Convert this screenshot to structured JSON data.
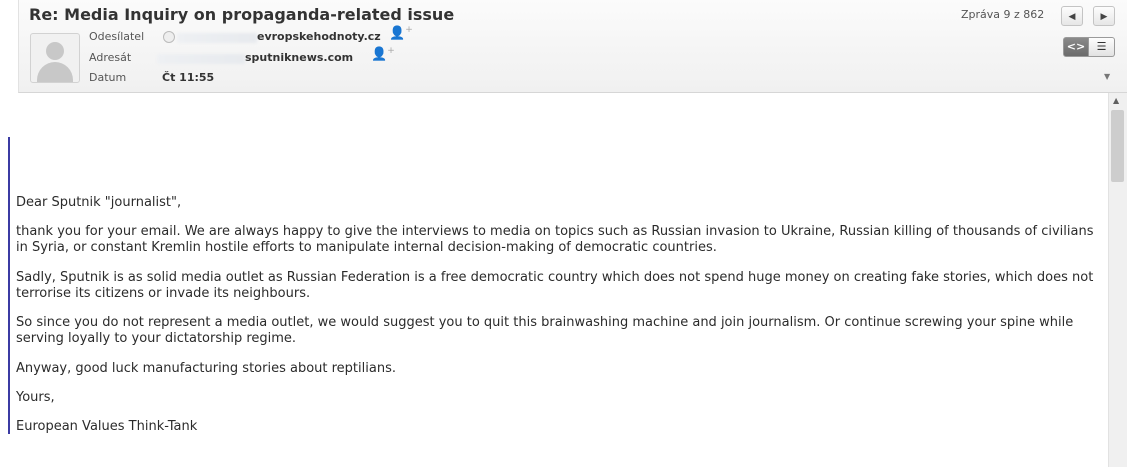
{
  "header": {
    "subject": "Re: Media Inquiry on propaganda-related issue",
    "sender_label": "Odesílatel",
    "sender_domain": "evropskehodnoty.cz",
    "recipient_label": "Adresát",
    "recipient_domain": "sputniknews.com",
    "date_label": "Datum",
    "date_value": "Čt 11:55",
    "counter": "Zpráva 9 z 862"
  },
  "icons": {
    "prev": "triangle-left",
    "next": "triangle-right",
    "source_view": "code-brackets",
    "plain_view": "hamburger-lines",
    "expand": "chevron-down",
    "add_contact": "person-plus"
  },
  "body": {
    "greeting": "Dear Sputnik \"journalist\",",
    "paragraphs": [
      "thank you for your email. We are always happy to give the interviews to media on topics such as Russian invasion to Ukraine, Russian killing of thousands of civilians in Syria, or constant Kremlin hostile efforts to manipulate internal decision-making of democratic countries.",
      "Sadly, Sputnik is as solid media outlet as Russian Federation is a free democratic country which does not spend huge money on creating fake stories, which does not terrorise its citizens or invade its neighbours.",
      "So since you do not represent a media outlet, we would suggest you to quit this brainwashing machine and join journalism. Or continue screwing your spine while serving loyally to your dictatorship regime.",
      "Anyway, good luck manufacturing stories about reptilians."
    ],
    "closing": "Yours,",
    "signature": "European Values Think-Tank"
  },
  "colors": {
    "quote_bar": "#3b3ba3",
    "header_bg": "#f4f4f4",
    "active_view_button": "#777777"
  }
}
